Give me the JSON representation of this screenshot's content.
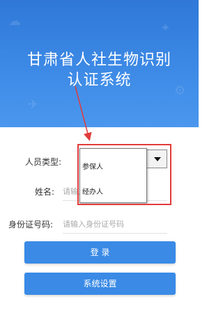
{
  "header": {
    "title_line1": "甘肃省人社生物识别",
    "title_line2": "认证系统"
  },
  "form": {
    "person_type_label": "人员类型:",
    "name_label": "姓名:",
    "name_placeholder": "请输入姓名",
    "id_label": "身份证号码:",
    "id_placeholder": "请输入身份证号码"
  },
  "dropdown": {
    "options": [
      "参保人",
      "经办人"
    ]
  },
  "buttons": {
    "login": "登 录",
    "settings": "系统设置"
  },
  "colors": {
    "header": "#3d8ae6",
    "button": "#3a8ae6",
    "highlight": "#e23b3b"
  }
}
